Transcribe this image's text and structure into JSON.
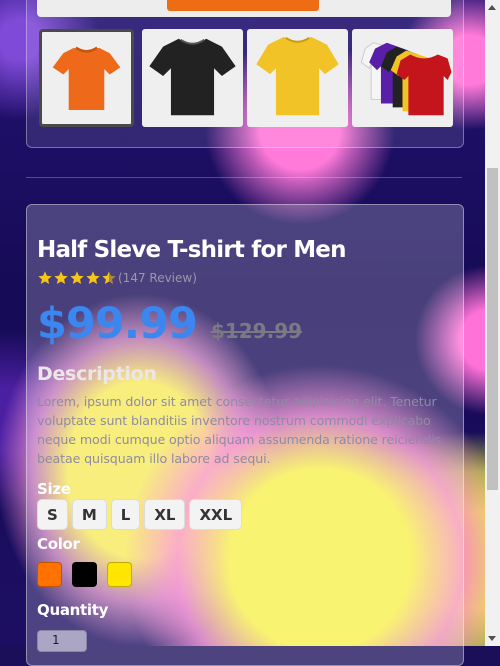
{
  "product": {
    "title": "Half Sleve T-shirt for Men",
    "rating": 4.5,
    "review_count": "(147 Review)",
    "price": "$99.99",
    "old_price": "$129.99",
    "description_heading": "Description",
    "description": "Lorem, ipsum dolor sit amet consectetur adipisicing elit. Tenetur voluptate sunt blanditiis inventore nostrum commodi explicabo neque modi cumque optio aliquam assumenda ratione reiciendis, beatae quisquam illo labore ad sequi.",
    "size_label": "Size",
    "sizes": [
      "S",
      "M",
      "L",
      "XL",
      "XXL"
    ],
    "color_label": "Color",
    "colors": [
      "#ff7200",
      "#000000",
      "#ffe600"
    ],
    "quantity_label": "Quantity",
    "quantity_value": "1"
  },
  "gallery": {
    "thumbnails": [
      {
        "name": "orange-tshirt",
        "color": "#ee6a1a"
      },
      {
        "name": "black-tshirt",
        "color": "#222222"
      },
      {
        "name": "yellow-tshirt",
        "color": "#f2c326"
      },
      {
        "name": "multicolor-tshirt-stack",
        "color": "#c4151c"
      }
    ],
    "active_index": 0
  },
  "theme": {
    "price_color": "#3c86f0",
    "star_color": "#f5c518"
  }
}
